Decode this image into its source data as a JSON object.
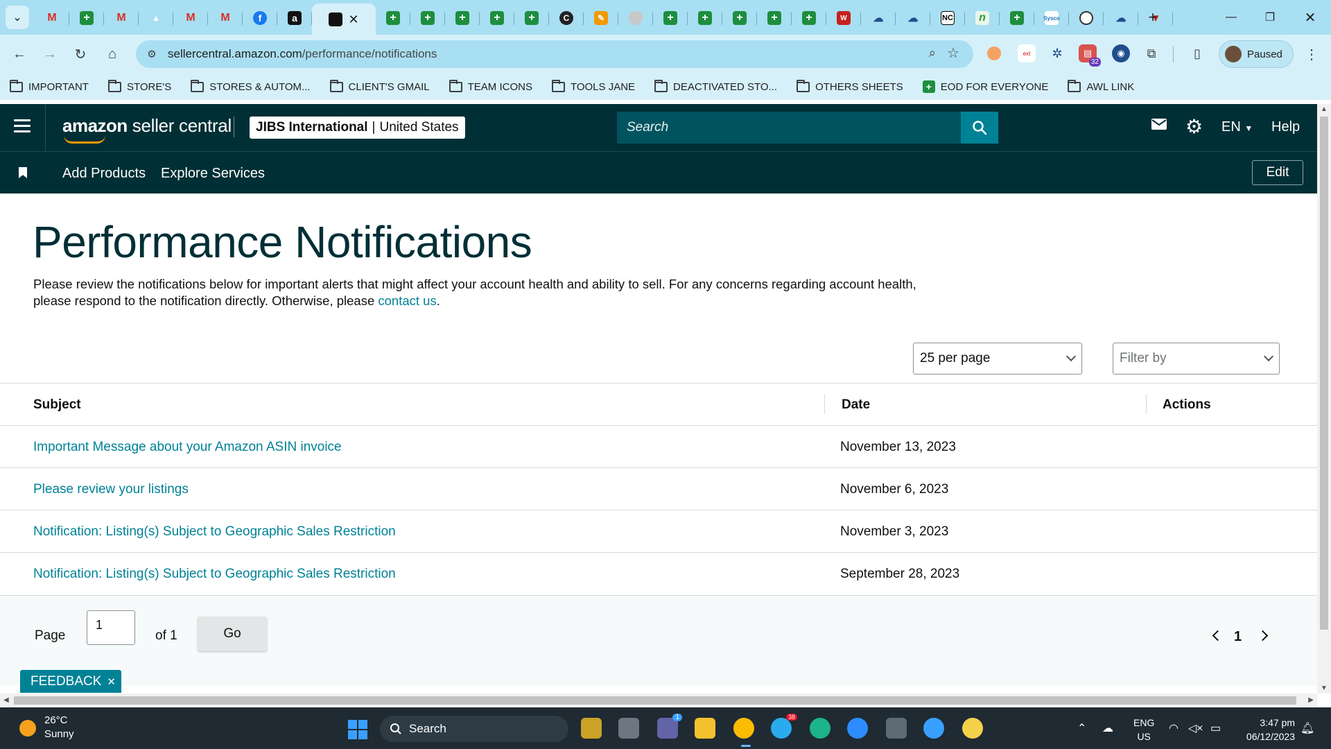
{
  "browser": {
    "tab_close_glyph": "✕",
    "tabs": [
      {
        "icon": "gmail-icon",
        "glyph": "M",
        "style": "m"
      },
      {
        "icon": "sheets-icon",
        "glyph": "+",
        "style": "plus"
      },
      {
        "icon": "gmail-icon",
        "glyph": "M",
        "style": "m"
      },
      {
        "icon": "drive-icon",
        "glyph": "▲",
        "style": "drive"
      },
      {
        "icon": "gmail-icon",
        "glyph": "M",
        "style": "m"
      },
      {
        "icon": "gmail-icon",
        "glyph": "M",
        "style": "m"
      },
      {
        "icon": "facebook-icon",
        "glyph": "f",
        "style": "fb"
      },
      {
        "icon": "amazon-icon",
        "glyph": "a",
        "style": "amz"
      },
      {
        "icon": "amazon-seller-icon",
        "glyph": "",
        "style": "active"
      },
      {
        "icon": "sheets-icon",
        "glyph": "+",
        "style": "plus"
      },
      {
        "icon": "sheets-icon",
        "glyph": "+",
        "style": "plus"
      },
      {
        "icon": "sheets-icon",
        "glyph": "+",
        "style": "plus"
      },
      {
        "icon": "sheets-icon",
        "glyph": "+",
        "style": "plus"
      },
      {
        "icon": "sheets-icon",
        "glyph": "+",
        "style": "plus"
      },
      {
        "icon": "c-icon",
        "glyph": "C",
        "style": "c"
      },
      {
        "icon": "pen-icon",
        "glyph": "✎",
        "style": "pen"
      },
      {
        "icon": "grey-circle-icon",
        "glyph": "",
        "style": "grey"
      },
      {
        "icon": "sheets-icon",
        "glyph": "+",
        "style": "plus"
      },
      {
        "icon": "sheets-icon",
        "glyph": "+",
        "style": "plus"
      },
      {
        "icon": "sheets-icon",
        "glyph": "+",
        "style": "plus"
      },
      {
        "icon": "sheets-icon",
        "glyph": "+",
        "style": "plus"
      },
      {
        "icon": "sheets-icon",
        "glyph": "+",
        "style": "plus"
      },
      {
        "icon": "w-icon",
        "glyph": "W",
        "style": "w"
      },
      {
        "icon": "cloud-icon",
        "glyph": "☁",
        "style": "cloud"
      },
      {
        "icon": "cloud-icon",
        "glyph": "☁",
        "style": "cloud"
      },
      {
        "icon": "nc-icon",
        "glyph": "NC",
        "style": "nc"
      },
      {
        "icon": "n-icon",
        "glyph": "n",
        "style": "n"
      },
      {
        "icon": "sheets-icon",
        "glyph": "+",
        "style": "plus"
      },
      {
        "icon": "sysco-icon",
        "glyph": "Sysco",
        "style": "sysco"
      },
      {
        "icon": "circle-logo-icon",
        "glyph": "",
        "style": "circ"
      },
      {
        "icon": "cloud-icon",
        "glyph": "☁",
        "style": "cloud"
      },
      {
        "icon": "v-icon",
        "glyph": "▼",
        "style": "v"
      }
    ],
    "url_host": "sellercentral.amazon.com",
    "url_path": "/performance/notifications",
    "profile_label": "Paused",
    "extension_badge": "32",
    "bookmarks": [
      {
        "label": "IMPORTANT",
        "type": "folder"
      },
      {
        "label": "STORE'S",
        "type": "folder"
      },
      {
        "label": "STORES & AUTOM...",
        "type": "folder"
      },
      {
        "label": "CLIENT'S GMAIL",
        "type": "folder"
      },
      {
        "label": "TEAM ICONS",
        "type": "folder"
      },
      {
        "label": "TOOLS JANE",
        "type": "folder"
      },
      {
        "label": "DEACTIVATED STO...",
        "type": "folder"
      },
      {
        "label": "OTHERS SHEETS",
        "type": "folder"
      },
      {
        "label": "EOD FOR EVERYONE",
        "type": "sheet"
      },
      {
        "label": "AWL LINK",
        "type": "folder"
      }
    ]
  },
  "header": {
    "logo_brand": "amazon",
    "logo_suffix": "seller central",
    "store_name": "JIBS International",
    "store_divider": "|",
    "store_region": "United States",
    "search_placeholder": "Search",
    "language": "EN",
    "help": "Help"
  },
  "subnav": {
    "links": [
      "Add Products",
      "Explore Services"
    ],
    "edit": "Edit"
  },
  "main": {
    "title": "Performance Notifications",
    "intro_text": "Please review the notifications below for important alerts that might affect your account health and ability to sell. For any concerns regarding account health, please respond to the notification directly. Otherwise, please ",
    "intro_link": "contact us",
    "intro_end": ".",
    "per_page": "25 per page",
    "filter_placeholder": "Filter by"
  },
  "table": {
    "headers": {
      "subject": "Subject",
      "date": "Date",
      "actions": "Actions"
    },
    "rows": [
      {
        "subject": "Important Message about your Amazon ASIN invoice",
        "date": "November 13, 2023"
      },
      {
        "subject": "Please review your listings",
        "date": "November 6, 2023"
      },
      {
        "subject": "Notification: Listing(s) Subject to Geographic Sales Restriction",
        "date": "November 3, 2023"
      },
      {
        "subject": "Notification: Listing(s) Subject to Geographic Sales Restriction",
        "date": "September 28, 2023"
      }
    ]
  },
  "pagination": {
    "page_label": "Page",
    "page_value": "1",
    "of_label": "of 1",
    "go": "Go",
    "current": "1"
  },
  "feedback": {
    "label": "FEEDBACK",
    "close": "✕"
  },
  "taskbar": {
    "temperature": "26°C",
    "condition": "Sunny",
    "search": "Search",
    "lang_line1": "ENG",
    "lang_line2": "US",
    "time": "3:47 pm",
    "date": "06/12/2023",
    "teams_badge": "1",
    "telegram_badge": "38"
  },
  "colors": {
    "header_bg": "#002f36",
    "link": "#008296",
    "chrome_tabstrip": "#a9dff2",
    "chrome_toolbar": "#d6f0fa"
  }
}
